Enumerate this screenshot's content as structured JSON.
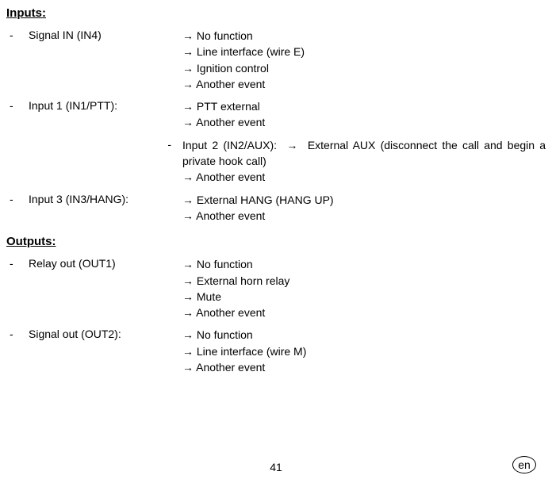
{
  "inputs": {
    "header": "Inputs:",
    "items": [
      {
        "label": "Signal IN (IN4)",
        "values": [
          "No function",
          "Line interface (wire E)",
          "Ignition control",
          "Another event"
        ]
      },
      {
        "label": "Input 1 (IN1/PTT):",
        "values": [
          "PTT external",
          "Another event"
        ],
        "sub": {
          "label_prefix": "Input 2 (IN2/AUX):",
          "first_value": "External AUX (disconnect the call and begin a  private hook call)",
          "rest": [
            "Another event"
          ]
        }
      },
      {
        "label": "Input 3 (IN3/HANG):",
        "values": [
          "External HANG (HANG UP)",
          "Another event"
        ]
      }
    ]
  },
  "outputs": {
    "header": "Outputs:",
    "items": [
      {
        "label": "Relay out (OUT1)",
        "values": [
          "No function",
          "External horn relay",
          "Mute",
          "Another event"
        ]
      },
      {
        "label": "Signal out (OUT2):",
        "values": [
          "No function",
          "Line interface (wire M)",
          "Another event"
        ]
      }
    ]
  },
  "page_number": "41",
  "lang_badge": "en",
  "arrow": "→",
  "bullet": "-"
}
